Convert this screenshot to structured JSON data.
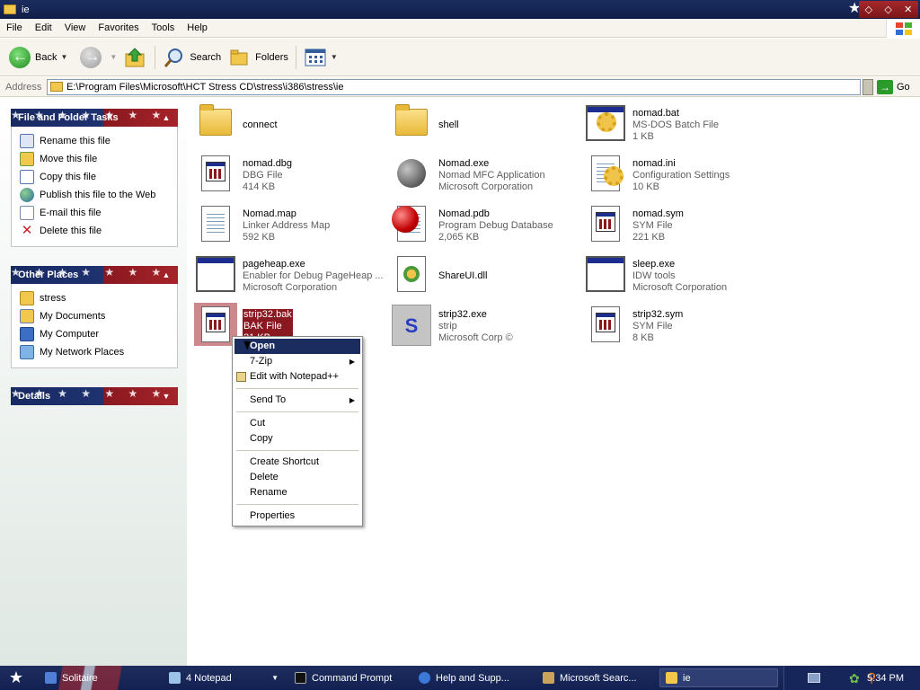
{
  "window": {
    "title": "ie",
    "controls": [
      "◇",
      "◇",
      "✕"
    ]
  },
  "menu": [
    "File",
    "Edit",
    "View",
    "Favorites",
    "Tools",
    "Help"
  ],
  "toolbar": {
    "back_label": "Back",
    "search_label": "Search",
    "folders_label": "Folders"
  },
  "address": {
    "label": "Address",
    "path": "E:\\Program Files\\Microsoft\\HCT Stress CD\\stress\\i386\\stress\\ie",
    "go_label": "Go"
  },
  "sidebar": {
    "file_tasks": {
      "title": "File and Folder Tasks",
      "items": [
        {
          "label": "Rename this file",
          "icon": "rename-icon"
        },
        {
          "label": "Move this file",
          "icon": "move-icon"
        },
        {
          "label": "Copy this file",
          "icon": "copy-icon"
        },
        {
          "label": "Publish this file to the Web",
          "icon": "globe-icon"
        },
        {
          "label": "E-mail this file",
          "icon": "email-icon"
        },
        {
          "label": "Delete this file",
          "icon": "delete-icon"
        }
      ]
    },
    "other_places": {
      "title": "Other Places",
      "items": [
        {
          "label": "stress",
          "icon": "folder-icon"
        },
        {
          "label": "My Documents",
          "icon": "my-documents-icon"
        },
        {
          "label": "My Computer",
          "icon": "my-computer-icon"
        },
        {
          "label": "My Network Places",
          "icon": "network-icon"
        }
      ]
    },
    "details": {
      "title": "Details"
    }
  },
  "files": [
    {
      "name": "connect",
      "type": "",
      "size": "",
      "icon": "folder"
    },
    {
      "name": "shell",
      "type": "",
      "size": "",
      "icon": "folder"
    },
    {
      "name": "nomad.bat",
      "type": "MS-DOS Batch File",
      "size": "1 KB",
      "icon": "bat"
    },
    {
      "name": "nomad.dbg",
      "type": "DBG File",
      "size": "414 KB",
      "icon": "generic"
    },
    {
      "name": "Nomad.exe",
      "type": "Nomad MFC Application",
      "size": "Microsoft Corporation",
      "icon": "globe"
    },
    {
      "name": "nomad.ini",
      "type": "Configuration Settings",
      "size": "10 KB",
      "icon": "ini"
    },
    {
      "name": "Nomad.map",
      "type": "Linker Address Map",
      "size": "592 KB",
      "icon": "text"
    },
    {
      "name": "Nomad.pdb",
      "type": "Program Debug Database",
      "size": "2,065 KB",
      "icon": "pdb"
    },
    {
      "name": "nomad.sym",
      "type": "SYM File",
      "size": "221 KB",
      "icon": "generic"
    },
    {
      "name": "pageheap.exe",
      "type": "Enabler for Debug PageHeap ...",
      "size": "Microsoft Corporation",
      "icon": "app"
    },
    {
      "name": "ShareUI.dll",
      "type": "",
      "size": "",
      "icon": "dll"
    },
    {
      "name": "sleep.exe",
      "type": "IDW tools",
      "size": "Microsoft Corporation",
      "icon": "app"
    },
    {
      "name": "strip32.bak",
      "type": "BAK File",
      "size": "21 KB",
      "icon": "generic"
    },
    {
      "name": "strip32.exe",
      "type": "strip",
      "size": "Microsoft Corp ©",
      "icon": "s"
    },
    {
      "name": "strip32.sym",
      "type": "SYM File",
      "size": "8 KB",
      "icon": "generic"
    }
  ],
  "context_menu": {
    "open": "Open",
    "zip": "7-Zip",
    "notepad": "Edit with Notepad++",
    "send_to": "Send To",
    "cut": "Cut",
    "copy": "Copy",
    "create_shortcut": "Create Shortcut",
    "delete": "Delete",
    "rename": "Rename",
    "properties": "Properties"
  },
  "taskbar": {
    "items": [
      {
        "label": "Solitaire"
      },
      {
        "label": "4 Notepad"
      },
      {
        "label": "Command Prompt"
      },
      {
        "label": "Help and Supp..."
      },
      {
        "label": "Microsoft Searc..."
      },
      {
        "label": "ie"
      }
    ],
    "clock": "5:34 PM"
  }
}
